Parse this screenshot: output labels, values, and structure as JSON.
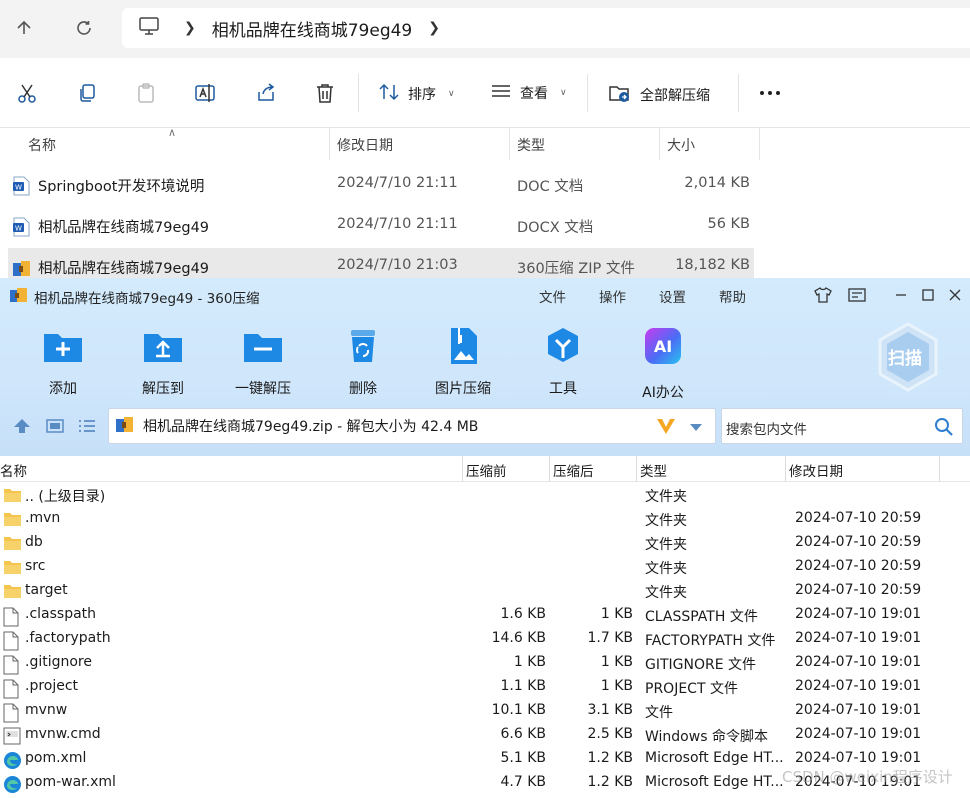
{
  "explorer": {
    "breadcrumb": "相机品牌在线商城79eg49",
    "toolbar": {
      "sort_label": "排序",
      "view_label": "查看",
      "extract_all_label": "全部解压缩"
    },
    "columns": {
      "name": "名称",
      "modified": "修改日期",
      "type": "类型",
      "size": "大小"
    },
    "files": [
      {
        "name": "Springboot开发环境说明",
        "modified": "2024/7/10 21:11",
        "type": "DOC 文档",
        "size": "2,014 KB",
        "icon": "word-doc-icon"
      },
      {
        "name": "相机品牌在线商城79eg49",
        "modified": "2024/7/10 21:11",
        "type": "DOCX 文档",
        "size": "56 KB",
        "icon": "word-doc-icon"
      },
      {
        "name": "相机品牌在线商城79eg49",
        "modified": "2024/7/10 21:03",
        "type": "360压缩 ZIP 文件",
        "size": "18,182 KB",
        "icon": "zip-archive-icon"
      }
    ]
  },
  "zip": {
    "title": "相机品牌在线商城79eg49 - 360压缩",
    "menu": [
      "文件",
      "操作",
      "设置",
      "帮助"
    ],
    "tools": [
      "添加",
      "解压到",
      "一键解压",
      "删除",
      "图片压缩",
      "工具",
      "AI办公"
    ],
    "scan_label": "扫描",
    "ai_badge": "AI",
    "path_text": "相机品牌在线商城79eg49.zip - 解包大小为 42.4 MB",
    "search_placeholder": "搜索包内文件",
    "columns": {
      "name": "名称",
      "packed": "压缩前",
      "compressed": "压缩后",
      "type": "类型",
      "modified": "修改日期"
    },
    "entries": [
      {
        "name": ".. (上级目录)",
        "packed": "",
        "compressed": "",
        "type": "文件夹",
        "modified": "",
        "icon": "folder-icon"
      },
      {
        "name": ".mvn",
        "packed": "",
        "compressed": "",
        "type": "文件夹",
        "modified": "2024-07-10 20:59",
        "icon": "folder-icon"
      },
      {
        "name": "db",
        "packed": "",
        "compressed": "",
        "type": "文件夹",
        "modified": "2024-07-10 20:59",
        "icon": "folder-icon"
      },
      {
        "name": "src",
        "packed": "",
        "compressed": "",
        "type": "文件夹",
        "modified": "2024-07-10 20:59",
        "icon": "folder-icon"
      },
      {
        "name": "target",
        "packed": "",
        "compressed": "",
        "type": "文件夹",
        "modified": "2024-07-10 20:59",
        "icon": "folder-icon"
      },
      {
        "name": ".classpath",
        "packed": "1.6 KB",
        "compressed": "1 KB",
        "type": "CLASSPATH 文件",
        "modified": "2024-07-10 19:01",
        "icon": "file-icon"
      },
      {
        "name": ".factorypath",
        "packed": "14.6 KB",
        "compressed": "1.7 KB",
        "type": "FACTORYPATH 文件",
        "modified": "2024-07-10 19:01",
        "icon": "file-icon"
      },
      {
        "name": ".gitignore",
        "packed": "1 KB",
        "compressed": "1 KB",
        "type": "GITIGNORE 文件",
        "modified": "2024-07-10 19:01",
        "icon": "file-icon"
      },
      {
        "name": ".project",
        "packed": "1.1 KB",
        "compressed": "1 KB",
        "type": "PROJECT 文件",
        "modified": "2024-07-10 19:01",
        "icon": "file-icon"
      },
      {
        "name": "mvnw",
        "packed": "10.1 KB",
        "compressed": "3.1 KB",
        "type": "文件",
        "modified": "2024-07-10 19:01",
        "icon": "file-icon"
      },
      {
        "name": "mvnw.cmd",
        "packed": "6.6 KB",
        "compressed": "2.5 KB",
        "type": "Windows 命令脚本",
        "modified": "2024-07-10 19:01",
        "icon": "cmd-script-icon"
      },
      {
        "name": "pom.xml",
        "packed": "5.1 KB",
        "compressed": "1.2 KB",
        "type": "Microsoft Edge HT...",
        "modified": "2024-07-10 19:01",
        "icon": "edge-icon"
      },
      {
        "name": "pom-war.xml",
        "packed": "4.7 KB",
        "compressed": "1.2 KB",
        "type": "Microsoft Edge HT...",
        "modified": "2024-07-10 19:01",
        "icon": "edge-icon"
      }
    ]
  },
  "watermark": "CSDN @weixin程序设计",
  "colors": {
    "accent": "#1e88e5",
    "zip_bg": "#d0e8fb",
    "selected_row": "#e9e9e9"
  }
}
